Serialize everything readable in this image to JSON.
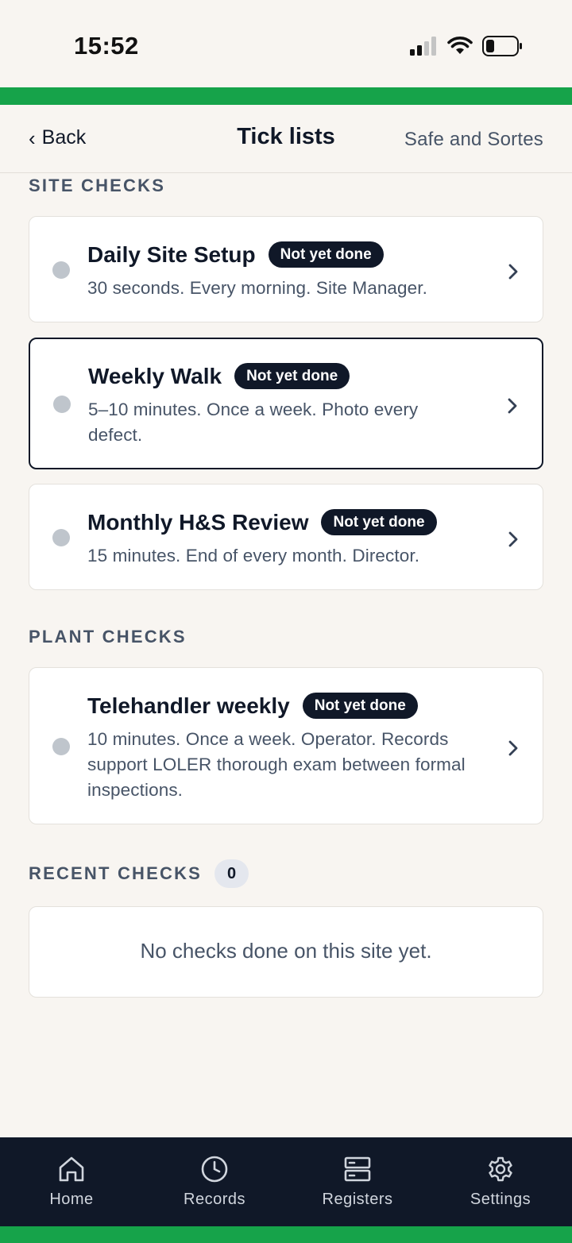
{
  "status_bar": {
    "time": "15:52"
  },
  "header": {
    "back_label": "Back",
    "title": "Tick lists",
    "site_name": "Safe and Sortes"
  },
  "sections": {
    "site_checks": {
      "label": "SITE CHECKS",
      "items": [
        {
          "title": "Daily Site Setup",
          "status": "Not yet done",
          "description": "30 seconds. Every morning. Site Manager."
        },
        {
          "title": "Weekly Walk",
          "status": "Not yet done",
          "description": "5–10 minutes. Once a week. Photo every defect."
        },
        {
          "title": "Monthly H&S Review",
          "status": "Not yet done",
          "description": "15 minutes. End of every month. Director."
        }
      ]
    },
    "plant_checks": {
      "label": "PLANT CHECKS",
      "items": [
        {
          "title": "Telehandler weekly",
          "status": "Not yet done",
          "description": "10 minutes. Once a week. Operator. Records support LOLER thorough exam between formal inspections."
        }
      ]
    },
    "recent_checks": {
      "label": "RECENT CHECKS",
      "count": "0",
      "empty_message": "No checks done on this site yet."
    }
  },
  "bottom_nav": [
    {
      "label": "Home",
      "icon": "home-icon"
    },
    {
      "label": "Records",
      "icon": "clock-icon"
    },
    {
      "label": "Registers",
      "icon": "server-icon"
    },
    {
      "label": "Settings",
      "icon": "gear-icon"
    }
  ],
  "colors": {
    "accent": "#16a34a",
    "dark": "#101828",
    "background": "#f8f5f1",
    "muted_text": "#475467",
    "dot": "#bfc5cc"
  }
}
